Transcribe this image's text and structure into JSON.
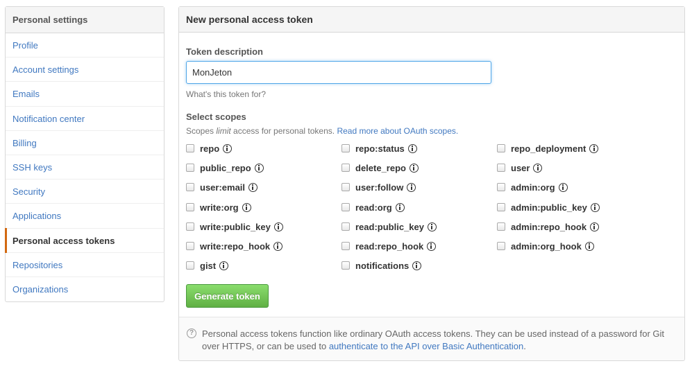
{
  "sidebar": {
    "header": "Personal settings",
    "items": [
      {
        "label": "Profile"
      },
      {
        "label": "Account settings"
      },
      {
        "label": "Emails"
      },
      {
        "label": "Notification center"
      },
      {
        "label": "Billing"
      },
      {
        "label": "SSH keys"
      },
      {
        "label": "Security"
      },
      {
        "label": "Applications"
      },
      {
        "label": "Personal access tokens",
        "active": true
      },
      {
        "label": "Repositories"
      },
      {
        "label": "Organizations"
      }
    ]
  },
  "panel": {
    "title": "New personal access token",
    "description_label": "Token description",
    "description_value": "MonJeton",
    "description_hint": "What's this token for?",
    "scopes_label": "Select scopes",
    "scopes_note_prefix": "Scopes ",
    "scopes_note_em": "limit",
    "scopes_note_mid": " access for personal tokens. ",
    "scopes_note_link": "Read more about OAuth scopes.",
    "scopes": [
      [
        "repo",
        "repo:status",
        "repo_deployment"
      ],
      [
        "public_repo",
        "delete_repo",
        "user"
      ],
      [
        "user:email",
        "user:follow",
        "admin:org"
      ],
      [
        "write:org",
        "read:org",
        "admin:public_key"
      ],
      [
        "write:public_key",
        "read:public_key",
        "admin:repo_hook"
      ],
      [
        "write:repo_hook",
        "read:repo_hook",
        "admin:org_hook"
      ],
      [
        "gist",
        "notifications"
      ]
    ],
    "generate_button": "Generate token",
    "footer_text": "Personal access tokens function like ordinary OAuth access tokens. They can be used instead of a password for Git over HTTPS, or can be used to ",
    "footer_link": "authenticate to the API over Basic Authentication",
    "footer_end": "."
  },
  "colors": {
    "accent": "#4078c0",
    "active_bar": "#d26911",
    "button": "#60b044"
  },
  "icons": {
    "scope_info": "info-icon",
    "footer": "question-icon"
  }
}
